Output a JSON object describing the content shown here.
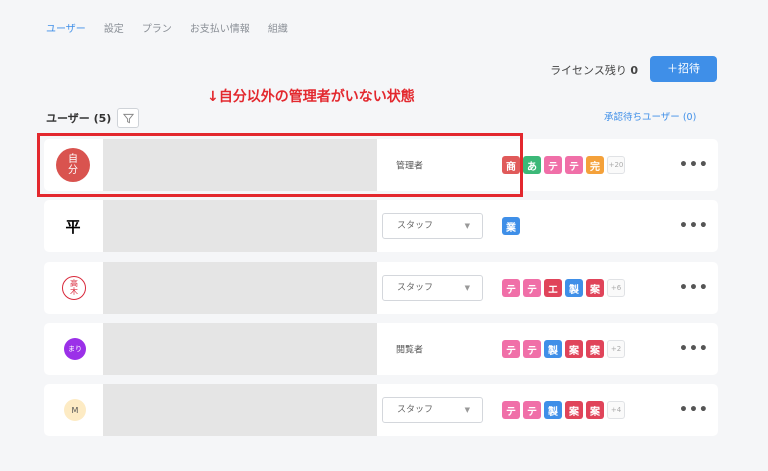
{
  "tabs": [
    {
      "label": "ユーザー",
      "active": true
    },
    {
      "label": "設定",
      "active": false
    },
    {
      "label": "プラン",
      "active": false
    },
    {
      "label": "お支払い情報",
      "active": false
    },
    {
      "label": "組織",
      "active": false
    }
  ],
  "license": {
    "label": "ライセンス残り",
    "count": "0"
  },
  "invite_button": "＋招待",
  "annotation": "↓自分以外の管理者がいない状態",
  "users_header": {
    "label": "ユーザー (5)"
  },
  "pending_link": "承認待ちユーザー (0)",
  "rows": [
    {
      "avatar": {
        "text": "自\n分",
        "line1": "自",
        "line2": "分",
        "bg": "#d9534f",
        "color": "#ffffff"
      },
      "role": "管理者",
      "tags": [
        {
          "text": "商",
          "color": "#e05a5a"
        },
        {
          "text": "あ",
          "color": "#3cb878"
        },
        {
          "text": "テ",
          "color": "#f06fa8"
        },
        {
          "text": "テ",
          "color": "#f06fa8"
        },
        {
          "text": "完",
          "color": "#f4a13a"
        }
      ],
      "more": "+20"
    },
    {
      "avatar": {
        "text": "平",
        "bg": "#ffffff",
        "color": "#000000"
      },
      "role": "スタッフ",
      "tags": [
        {
          "text": "業",
          "color": "#3f8fe8"
        }
      ],
      "more": ""
    },
    {
      "avatar": {
        "text": "高木",
        "line1": "高",
        "line2": "木",
        "bg": "#ffffff",
        "color": "#d9283a"
      },
      "role": "スタッフ",
      "tags": [
        {
          "text": "テ",
          "color": "#f06fa8"
        },
        {
          "text": "テ",
          "color": "#f06fa8"
        },
        {
          "text": "エ",
          "color": "#e0445a"
        },
        {
          "text": "製",
          "color": "#3f8fe8"
        },
        {
          "text": "案",
          "color": "#e0445a"
        }
      ],
      "more": "+6"
    },
    {
      "avatar": {
        "text": "まり",
        "bg": "#9b30e8",
        "color": "#ffffff"
      },
      "role": "閲覧者",
      "tags": [
        {
          "text": "テ",
          "color": "#f06fa8"
        },
        {
          "text": "テ",
          "color": "#f06fa8"
        },
        {
          "text": "製",
          "color": "#3f8fe8"
        },
        {
          "text": "案",
          "color": "#e0445a"
        },
        {
          "text": "案",
          "color": "#e0445a"
        }
      ],
      "more": "+2"
    },
    {
      "avatar": {
        "text": "M",
        "bg": "#fdebc4",
        "color": "#555555"
      },
      "role": "スタッフ",
      "tags": [
        {
          "text": "テ",
          "color": "#f06fa8"
        },
        {
          "text": "テ",
          "color": "#f06fa8"
        },
        {
          "text": "製",
          "color": "#3f8fe8"
        },
        {
          "text": "案",
          "color": "#e0445a"
        },
        {
          "text": "案",
          "color": "#e0445a"
        }
      ],
      "more": "+4"
    }
  ],
  "row_menu_glyph": "•••"
}
